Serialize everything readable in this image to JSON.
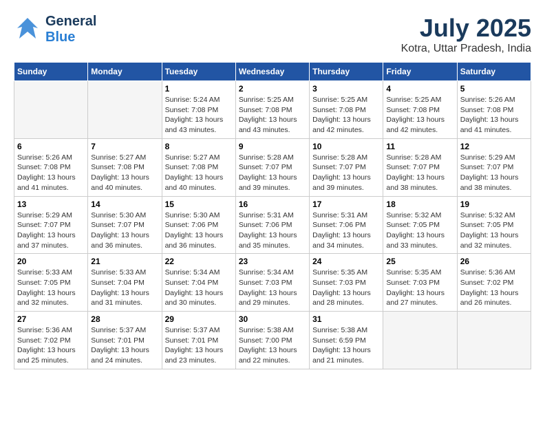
{
  "header": {
    "logo_general": "General",
    "logo_blue": "Blue",
    "month_year": "July 2025",
    "location": "Kotra, Uttar Pradesh, India"
  },
  "weekdays": [
    "Sunday",
    "Monday",
    "Tuesday",
    "Wednesday",
    "Thursday",
    "Friday",
    "Saturday"
  ],
  "weeks": [
    [
      {
        "day": "",
        "info": ""
      },
      {
        "day": "",
        "info": ""
      },
      {
        "day": "1",
        "info": "Sunrise: 5:24 AM\nSunset: 7:08 PM\nDaylight: 13 hours and 43 minutes."
      },
      {
        "day": "2",
        "info": "Sunrise: 5:25 AM\nSunset: 7:08 PM\nDaylight: 13 hours and 43 minutes."
      },
      {
        "day": "3",
        "info": "Sunrise: 5:25 AM\nSunset: 7:08 PM\nDaylight: 13 hours and 42 minutes."
      },
      {
        "day": "4",
        "info": "Sunrise: 5:25 AM\nSunset: 7:08 PM\nDaylight: 13 hours and 42 minutes."
      },
      {
        "day": "5",
        "info": "Sunrise: 5:26 AM\nSunset: 7:08 PM\nDaylight: 13 hours and 41 minutes."
      }
    ],
    [
      {
        "day": "6",
        "info": "Sunrise: 5:26 AM\nSunset: 7:08 PM\nDaylight: 13 hours and 41 minutes."
      },
      {
        "day": "7",
        "info": "Sunrise: 5:27 AM\nSunset: 7:08 PM\nDaylight: 13 hours and 40 minutes."
      },
      {
        "day": "8",
        "info": "Sunrise: 5:27 AM\nSunset: 7:08 PM\nDaylight: 13 hours and 40 minutes."
      },
      {
        "day": "9",
        "info": "Sunrise: 5:28 AM\nSunset: 7:07 PM\nDaylight: 13 hours and 39 minutes."
      },
      {
        "day": "10",
        "info": "Sunrise: 5:28 AM\nSunset: 7:07 PM\nDaylight: 13 hours and 39 minutes."
      },
      {
        "day": "11",
        "info": "Sunrise: 5:28 AM\nSunset: 7:07 PM\nDaylight: 13 hours and 38 minutes."
      },
      {
        "day": "12",
        "info": "Sunrise: 5:29 AM\nSunset: 7:07 PM\nDaylight: 13 hours and 38 minutes."
      }
    ],
    [
      {
        "day": "13",
        "info": "Sunrise: 5:29 AM\nSunset: 7:07 PM\nDaylight: 13 hours and 37 minutes."
      },
      {
        "day": "14",
        "info": "Sunrise: 5:30 AM\nSunset: 7:07 PM\nDaylight: 13 hours and 36 minutes."
      },
      {
        "day": "15",
        "info": "Sunrise: 5:30 AM\nSunset: 7:06 PM\nDaylight: 13 hours and 36 minutes."
      },
      {
        "day": "16",
        "info": "Sunrise: 5:31 AM\nSunset: 7:06 PM\nDaylight: 13 hours and 35 minutes."
      },
      {
        "day": "17",
        "info": "Sunrise: 5:31 AM\nSunset: 7:06 PM\nDaylight: 13 hours and 34 minutes."
      },
      {
        "day": "18",
        "info": "Sunrise: 5:32 AM\nSunset: 7:05 PM\nDaylight: 13 hours and 33 minutes."
      },
      {
        "day": "19",
        "info": "Sunrise: 5:32 AM\nSunset: 7:05 PM\nDaylight: 13 hours and 32 minutes."
      }
    ],
    [
      {
        "day": "20",
        "info": "Sunrise: 5:33 AM\nSunset: 7:05 PM\nDaylight: 13 hours and 32 minutes."
      },
      {
        "day": "21",
        "info": "Sunrise: 5:33 AM\nSunset: 7:04 PM\nDaylight: 13 hours and 31 minutes."
      },
      {
        "day": "22",
        "info": "Sunrise: 5:34 AM\nSunset: 7:04 PM\nDaylight: 13 hours and 30 minutes."
      },
      {
        "day": "23",
        "info": "Sunrise: 5:34 AM\nSunset: 7:03 PM\nDaylight: 13 hours and 29 minutes."
      },
      {
        "day": "24",
        "info": "Sunrise: 5:35 AM\nSunset: 7:03 PM\nDaylight: 13 hours and 28 minutes."
      },
      {
        "day": "25",
        "info": "Sunrise: 5:35 AM\nSunset: 7:03 PM\nDaylight: 13 hours and 27 minutes."
      },
      {
        "day": "26",
        "info": "Sunrise: 5:36 AM\nSunset: 7:02 PM\nDaylight: 13 hours and 26 minutes."
      }
    ],
    [
      {
        "day": "27",
        "info": "Sunrise: 5:36 AM\nSunset: 7:02 PM\nDaylight: 13 hours and 25 minutes."
      },
      {
        "day": "28",
        "info": "Sunrise: 5:37 AM\nSunset: 7:01 PM\nDaylight: 13 hours and 24 minutes."
      },
      {
        "day": "29",
        "info": "Sunrise: 5:37 AM\nSunset: 7:01 PM\nDaylight: 13 hours and 23 minutes."
      },
      {
        "day": "30",
        "info": "Sunrise: 5:38 AM\nSunset: 7:00 PM\nDaylight: 13 hours and 22 minutes."
      },
      {
        "day": "31",
        "info": "Sunrise: 5:38 AM\nSunset: 6:59 PM\nDaylight: 13 hours and 21 minutes."
      },
      {
        "day": "",
        "info": ""
      },
      {
        "day": "",
        "info": ""
      }
    ]
  ]
}
